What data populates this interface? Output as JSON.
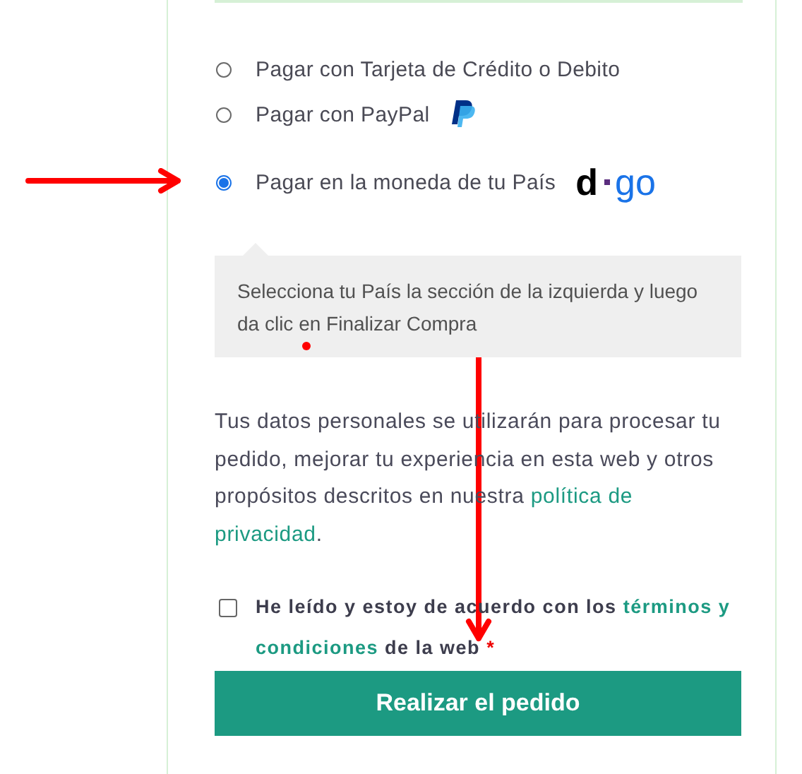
{
  "payment_methods": [
    {
      "label": "Pagar con Tarjeta de Crédito o Debito",
      "selected": false,
      "kind": "plain"
    },
    {
      "label": "Pagar con PayPal",
      "selected": false,
      "kind": "paypal"
    },
    {
      "label": "Pagar en la moneda de tu País",
      "selected": true,
      "kind": "dgo",
      "logo": {
        "left": "d",
        "right": "go"
      }
    }
  ],
  "notice": "Selecciona tu País la sección de la izquierda y luego da clic en Finalizar Compra",
  "privacy": {
    "text": "Tus datos personales se utilizarán para procesar tu pedido, mejorar tu experiencia en esta web y otros propósitos descritos en nuestra",
    "link": [
      "política de",
      "privacidad"
    ],
    "end": "."
  },
  "terms": {
    "checked": false,
    "text": "He leído y estoy de acuerdo con los",
    "link": [
      "términos y",
      "condiciones"
    ],
    "after": "de la web",
    "required": "*"
  },
  "submit": "Realizar el pedido"
}
